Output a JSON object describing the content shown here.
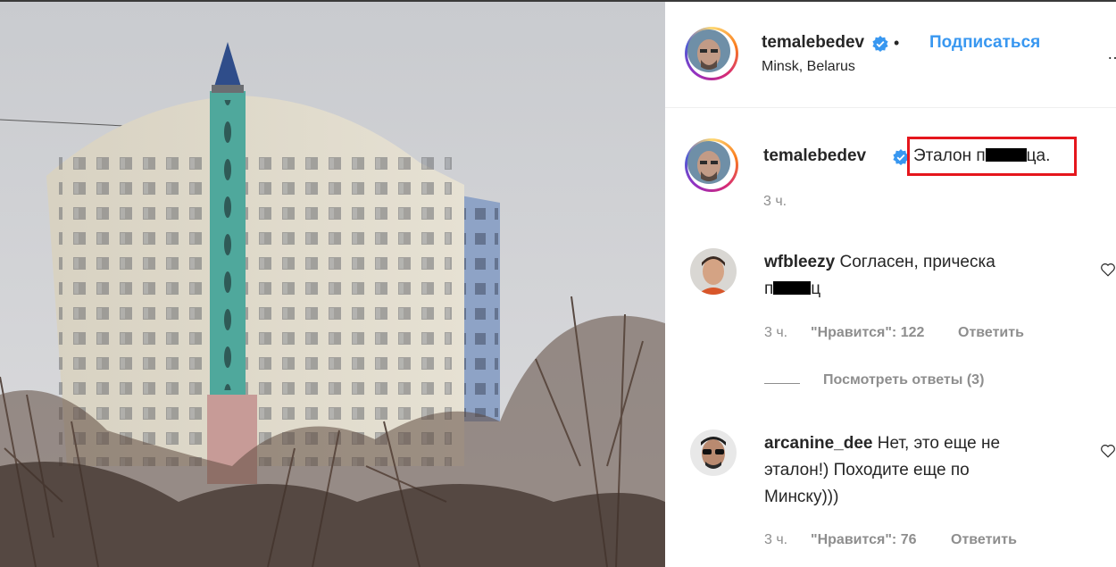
{
  "post": {
    "username": "temalebedev",
    "separator": "•",
    "follow_label": "Подписаться",
    "location": "Minsk, Belarus",
    "more_label": "…"
  },
  "caption": {
    "username": "temalebedev",
    "text_before": "Эталон п",
    "text_after": "ца.",
    "time": "3 ч."
  },
  "comments": [
    {
      "username": "wfbleezy",
      "text_line1": "Согласен, прическа",
      "text_line2_before": "п",
      "text_line2_after": "ц",
      "time": "3 ч.",
      "likes": "\"Нравится\": 122",
      "reply_label": "Ответить"
    },
    {
      "username": "arcanine_dee",
      "text_line1": "Нет, это еще не",
      "text_line2": "эталон!) Походите еще по",
      "text_line3": "Минску)))",
      "time": "3 ч.",
      "likes": "\"Нравится\": 76",
      "reply_label": "Ответить"
    }
  ],
  "view_replies_label": "Посмотреть ответы (3)",
  "colors": {
    "link_blue": "#3897f0",
    "verified_blue": "#3897f0",
    "highlight_red": "#e5161d",
    "muted_text": "#8e8e8e"
  },
  "icons": [
    "verified-badge-icon",
    "heart-icon",
    "more-options-icon"
  ]
}
